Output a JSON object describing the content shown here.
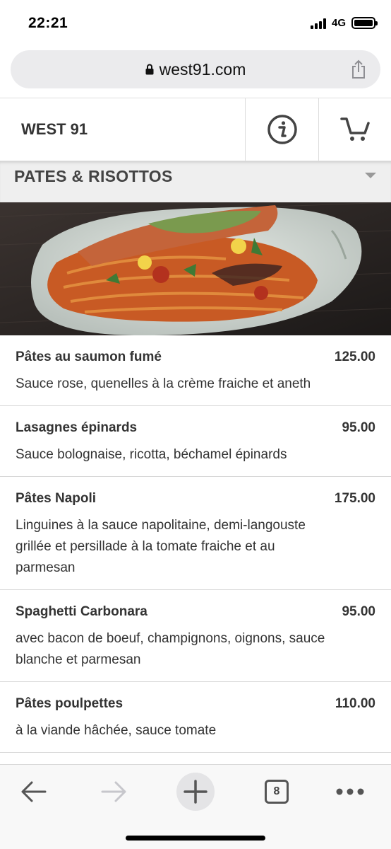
{
  "status_bar": {
    "time": "22:21",
    "network": "4G",
    "battery_level": 1.0
  },
  "browser": {
    "url": "west91.com",
    "icons": [
      "lock-icon",
      "share-icon"
    ]
  },
  "header": {
    "brand": "WEST 91",
    "icons": [
      "info-icon",
      "cart-icon"
    ]
  },
  "category": {
    "title": "PATES & RISOTTOS",
    "icon": "chevron-down-icon"
  },
  "menu": {
    "items": [
      {
        "name": "Pâtes au saumon fumé",
        "price": "125.00",
        "description": "Sauce rose, quenelles à la crème fraiche et aneth"
      },
      {
        "name": "Lasagnes épinards",
        "price": "95.00",
        "description": "Sauce bolognaise, ricotta, béchamel épinards"
      },
      {
        "name": "Pâtes Napoli",
        "price": "175.00",
        "description": "Linguines à la sauce napolitaine, demi-langouste grillée et persillade à la tomate fraiche et au parmesan"
      },
      {
        "name": "Spaghetti Carbonara",
        "price": "95.00",
        "description": "avec bacon de boeuf, champignons, oignons, sauce blanche et parmesan"
      },
      {
        "name": "Pâtes poulpettes",
        "price": "110.00",
        "description": "à la viande hâchée, sauce tomate"
      }
    ]
  },
  "toolbar": {
    "tab_count": "8",
    "icons": [
      "back-arrow-icon",
      "forward-arrow-icon",
      "plus-icon",
      "tabs-icon",
      "more-icon"
    ]
  },
  "colors": {
    "text": "#333333",
    "category_bg": "#efefef",
    "url_bar_bg": "#ebebed",
    "disabled": "#c7c7cc"
  }
}
